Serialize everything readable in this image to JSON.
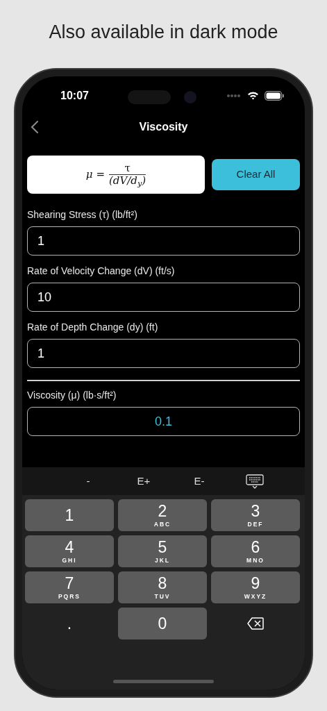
{
  "caption": "Also available in dark mode",
  "status_bar": {
    "time": "10:07"
  },
  "nav": {
    "title": "Viscosity"
  },
  "formula": {
    "lhs": "μ =",
    "numerator": "τ",
    "denominator": "(dV/d$_{y}$)"
  },
  "clear_button": "Clear All",
  "inputs": [
    {
      "label": "Shearing Stress (τ) (lb/ft²)",
      "value": "1"
    },
    {
      "label": "Rate of Velocity Change (dV) (ft/s)",
      "value": "10"
    },
    {
      "label": "Rate of Depth Change (dy) (ft)",
      "value": "1"
    }
  ],
  "result": {
    "label": "Viscosity (μ) (lb·s/ft²)",
    "value": "0.1"
  },
  "keyboard_toolbar": [
    {
      "kind": "text",
      "label": "-"
    },
    {
      "kind": "text",
      "label": "E+"
    },
    {
      "kind": "text",
      "label": "E-"
    },
    {
      "kind": "dismiss"
    }
  ],
  "keys": [
    {
      "kind": "digit",
      "digit": "1"
    },
    {
      "kind": "digit",
      "digit": "2",
      "letters": "ABC"
    },
    {
      "kind": "digit",
      "digit": "3",
      "letters": "DEF"
    },
    {
      "kind": "digit",
      "digit": "4",
      "letters": "GHI"
    },
    {
      "kind": "digit",
      "digit": "5",
      "letters": "JKL"
    },
    {
      "kind": "digit",
      "digit": "6",
      "letters": "MNO"
    },
    {
      "kind": "digit",
      "digit": "7",
      "letters": "PQRS"
    },
    {
      "kind": "digit",
      "digit": "8",
      "letters": "TUV"
    },
    {
      "kind": "digit",
      "digit": "9",
      "letters": "WXYZ"
    },
    {
      "kind": "plain",
      "digit": "."
    },
    {
      "kind": "digit",
      "digit": "0"
    },
    {
      "kind": "backspace"
    }
  ]
}
